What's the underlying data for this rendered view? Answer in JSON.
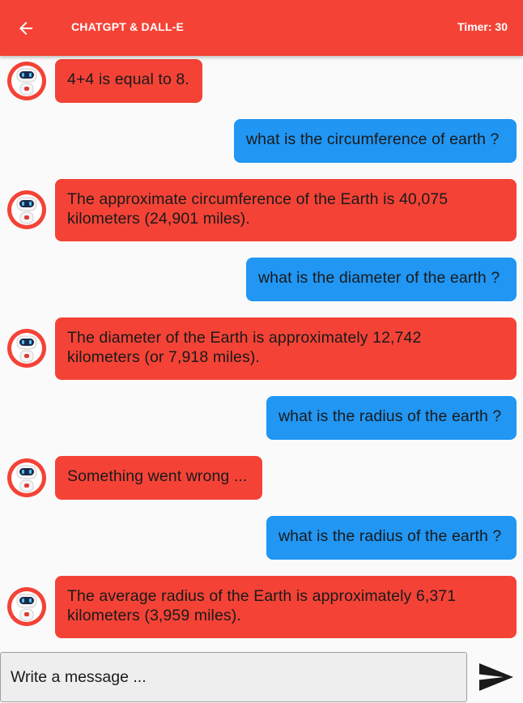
{
  "app": {
    "title": "CHATGPT & DALL-E",
    "timer": "Timer: 30",
    "accent_color": "#f44336",
    "user_bubble_color": "#2196f3"
  },
  "icons": {
    "back": "arrow-left-icon",
    "send": "send-icon",
    "bot_avatar": "robot-avatar"
  },
  "messages": [
    {
      "sender": "bot",
      "lines": [
        "4+4 is equal to 8."
      ]
    },
    {
      "sender": "user",
      "lines": [
        "what is the circumference of earth ?"
      ]
    },
    {
      "sender": "bot",
      "lines": [
        "The approximate circumference of the Earth is 40,075",
        "kilometers (24,901 miles)."
      ]
    },
    {
      "sender": "user",
      "lines": [
        "what is the diameter of the earth ?"
      ]
    },
    {
      "sender": "bot",
      "lines": [
        "The diameter of the Earth is approximately 12,742",
        "kilometers (or 7,918 miles)."
      ]
    },
    {
      "sender": "user",
      "lines": [
        "what is the radius of the earth ?"
      ]
    },
    {
      "sender": "bot",
      "lines": [
        "Something went wrong ..."
      ]
    },
    {
      "sender": "user",
      "lines": [
        "what is the radius of the earth ?"
      ]
    },
    {
      "sender": "bot",
      "lines": [
        "The average radius of the Earth is approximately 6,371",
        "kilometers (3,959 miles)."
      ]
    }
  ],
  "composer": {
    "placeholder": "Write a message ...",
    "value": ""
  }
}
